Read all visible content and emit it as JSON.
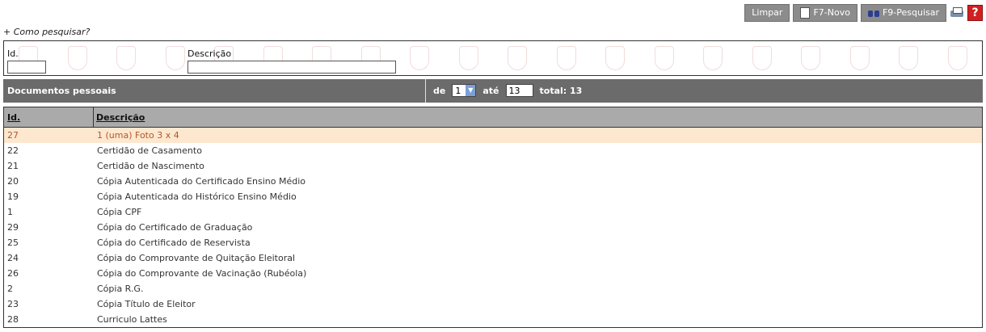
{
  "toolbar": {
    "clear_label": "Limpar",
    "new_label": "F7-Novo",
    "search_label": "F9-Pesquisar",
    "help_label": "?"
  },
  "howto_link": "+ Como pesquisar?",
  "filter": {
    "id_label": "Id.",
    "id_value": "",
    "desc_label": "Descrição",
    "desc_value": ""
  },
  "results_bar": {
    "title": "Documentos pessoais",
    "from_label": "de",
    "from_value": "1",
    "to_label": "até",
    "to_value": "13",
    "total_label": "total: 13"
  },
  "table": {
    "headers": {
      "id": "Id.",
      "desc": "Descrição"
    },
    "rows": [
      {
        "id": "27",
        "desc": "1 (uma) Foto 3 x 4"
      },
      {
        "id": "22",
        "desc": "Certidão de Casamento"
      },
      {
        "id": "21",
        "desc": "Certidão de Nascimento"
      },
      {
        "id": "20",
        "desc": "Cópia Autenticada do Certificado Ensino Médio"
      },
      {
        "id": "19",
        "desc": "Cópia Autenticada do Histórico Ensino Médio"
      },
      {
        "id": "1",
        "desc": "Cópia CPF"
      },
      {
        "id": "29",
        "desc": "Cópia do Certificado de Graduação"
      },
      {
        "id": "25",
        "desc": "Cópia do Certificado de Reservista"
      },
      {
        "id": "24",
        "desc": "Cópia do Comprovante de Quitação Eleitoral"
      },
      {
        "id": "26",
        "desc": "Cópia do Comprovante de Vacinação (Rubéola)"
      },
      {
        "id": "2",
        "desc": "Cópia R.G."
      },
      {
        "id": "23",
        "desc": "Cópia Título de Eleitor"
      },
      {
        "id": "28",
        "desc": "Curriculo Lattes"
      }
    ]
  },
  "colors": {
    "highlight_bg": "#fde7cf",
    "highlight_text": "#b05a2a",
    "bar_bg": "#6b6b6b",
    "header_bg": "#aaaaaa"
  }
}
